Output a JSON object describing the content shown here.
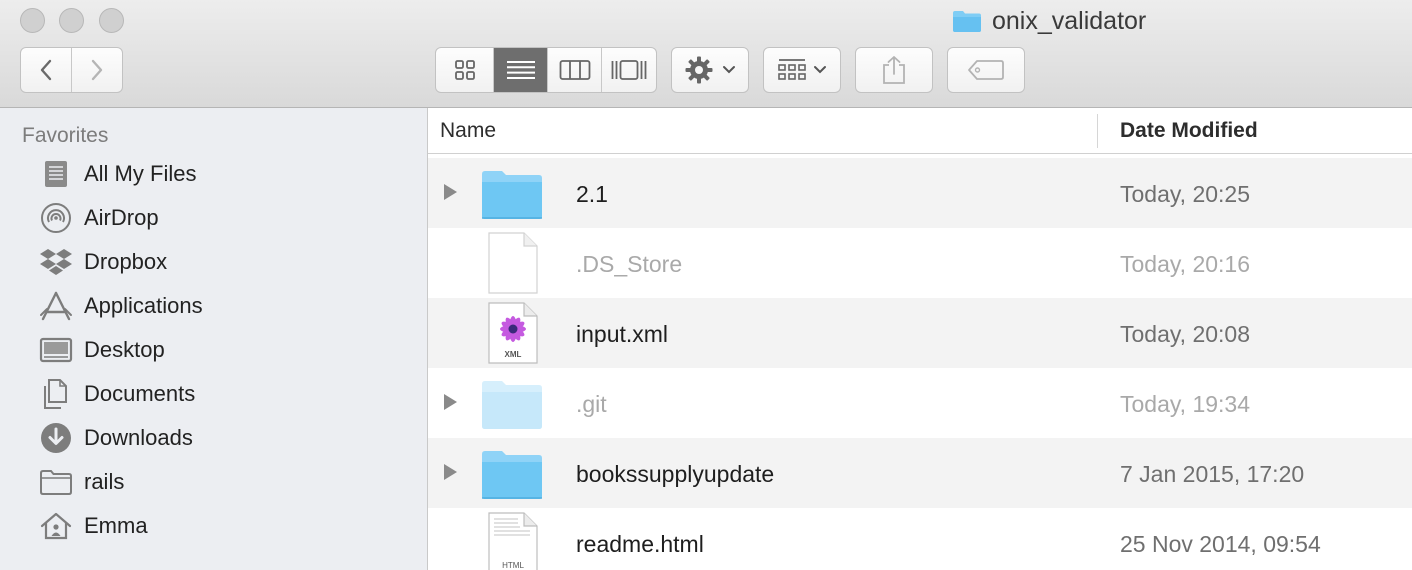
{
  "window": {
    "title": "onix_validator"
  },
  "toolbar": {
    "icons": [
      "icon-view-button",
      "list-view-button",
      "column-view-button",
      "cover-flow-button",
      "action-gear-button",
      "arrange-button",
      "share-button",
      "tag-button"
    ],
    "selected_view": "list"
  },
  "sidebar": {
    "heading": "Favorites",
    "items": [
      {
        "label": "All My Files",
        "icon": "all-files-icon"
      },
      {
        "label": "AirDrop",
        "icon": "airdrop-icon"
      },
      {
        "label": "Dropbox",
        "icon": "dropbox-icon"
      },
      {
        "label": "Applications",
        "icon": "applications-icon"
      },
      {
        "label": "Desktop",
        "icon": "desktop-icon"
      },
      {
        "label": "Documents",
        "icon": "documents-icon"
      },
      {
        "label": "Downloads",
        "icon": "downloads-icon"
      },
      {
        "label": "rails",
        "icon": "folder-icon"
      },
      {
        "label": "Emma",
        "icon": "home-icon"
      }
    ]
  },
  "list": {
    "columns": {
      "name": "Name",
      "date": "Date Modified"
    },
    "rows": [
      {
        "name": "2.1",
        "date": "Today, 20:25",
        "kind": "folder"
      },
      {
        "name": ".DS_Store",
        "date": "Today, 20:16",
        "kind": "document"
      },
      {
        "name": "input.xml",
        "date": "Today, 20:08",
        "kind": "xml"
      },
      {
        "name": ".git",
        "date": "Today, 19:34",
        "kind": "folder"
      },
      {
        "name": "bookssupplyupdate",
        "date": "7 Jan 2015, 17:20",
        "kind": "folder"
      },
      {
        "name": "readme.html",
        "date": "25 Nov 2014, 09:54",
        "kind": "html"
      }
    ]
  },
  "colors": {
    "folder": "#6ec7f3",
    "folder_dim": "#c6e8fa",
    "sidebar_bg": "#eceef2",
    "selected_view": "#6e6e6e"
  }
}
